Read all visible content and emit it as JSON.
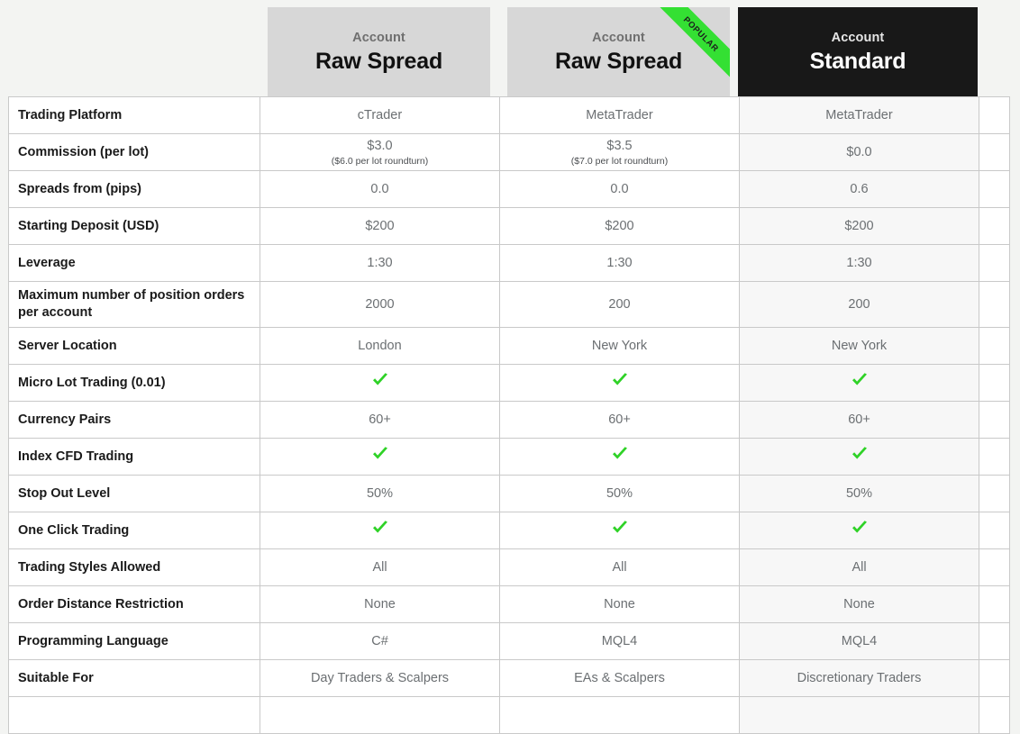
{
  "theme": {
    "page_background": "#f3f4f2",
    "card_gray": "#d7d7d7",
    "card_dark": "#181818",
    "ribbon_green": "#34e033",
    "check_green": "#2fd227",
    "shaded_column": "#f7f7f7",
    "border": "#c9c9c9"
  },
  "header": {
    "cards": [
      {
        "kicker": "Account",
        "title": "Raw Spread",
        "badge": null
      },
      {
        "kicker": "Account",
        "title": "Raw Spread",
        "badge": "POPULAR"
      },
      {
        "kicker": "Account",
        "title": "Standard",
        "badge": null
      }
    ]
  },
  "table": {
    "rows": [
      {
        "label": "Trading Platform",
        "values": [
          {
            "text": "cTrader"
          },
          {
            "text": "MetaTrader"
          },
          {
            "text": "MetaTrader"
          }
        ]
      },
      {
        "label": "Commission (per lot)",
        "values": [
          {
            "text": "$3.0",
            "sub": "($6.0 per lot roundturn)"
          },
          {
            "text": "$3.5",
            "sub": "($7.0 per lot roundturn)"
          },
          {
            "text": "$0.0"
          }
        ]
      },
      {
        "label": "Spreads from (pips)",
        "values": [
          {
            "text": "0.0"
          },
          {
            "text": "0.0"
          },
          {
            "text": "0.6"
          }
        ]
      },
      {
        "label": "Starting Deposit (USD)",
        "values": [
          {
            "text": "$200"
          },
          {
            "text": "$200"
          },
          {
            "text": "$200"
          }
        ]
      },
      {
        "label": "Leverage",
        "values": [
          {
            "text": "1:30"
          },
          {
            "text": "1:30"
          },
          {
            "text": "1:30"
          }
        ]
      },
      {
        "label": "Maximum number of position orders per account",
        "values": [
          {
            "text": "2000"
          },
          {
            "text": "200"
          },
          {
            "text": "200"
          }
        ]
      },
      {
        "label": "Server Location",
        "values": [
          {
            "text": "London"
          },
          {
            "text": "New York"
          },
          {
            "text": "New York"
          }
        ]
      },
      {
        "label": "Micro Lot Trading (0.01)",
        "values": [
          {
            "icon": "check-icon"
          },
          {
            "icon": "check-icon"
          },
          {
            "icon": "check-icon"
          }
        ]
      },
      {
        "label": "Currency Pairs",
        "values": [
          {
            "text": "60+"
          },
          {
            "text": "60+"
          },
          {
            "text": "60+"
          }
        ]
      },
      {
        "label": "Index CFD Trading",
        "values": [
          {
            "icon": "check-icon"
          },
          {
            "icon": "check-icon"
          },
          {
            "icon": "check-icon"
          }
        ]
      },
      {
        "label": "Stop Out Level",
        "values": [
          {
            "text": "50%"
          },
          {
            "text": "50%"
          },
          {
            "text": "50%"
          }
        ]
      },
      {
        "label": "One Click Trading",
        "values": [
          {
            "icon": "check-icon"
          },
          {
            "icon": "check-icon"
          },
          {
            "icon": "check-icon"
          }
        ]
      },
      {
        "label": "Trading Styles Allowed",
        "values": [
          {
            "text": "All"
          },
          {
            "text": "All"
          },
          {
            "text": "All"
          }
        ]
      },
      {
        "label": "Order Distance Restriction",
        "values": [
          {
            "text": "None"
          },
          {
            "text": "None"
          },
          {
            "text": "None"
          }
        ]
      },
      {
        "label": "Programming Language",
        "values": [
          {
            "text": "C#"
          },
          {
            "text": "MQL4"
          },
          {
            "text": "MQL4"
          }
        ]
      },
      {
        "label": "Suitable For",
        "values": [
          {
            "text": "Day Traders & Scalpers"
          },
          {
            "text": "EAs & Scalpers"
          },
          {
            "text": "Discretionary Traders"
          }
        ]
      },
      {
        "label": "",
        "values": [
          {
            "text": ""
          },
          {
            "text": ""
          },
          {
            "text": ""
          }
        ]
      }
    ]
  }
}
